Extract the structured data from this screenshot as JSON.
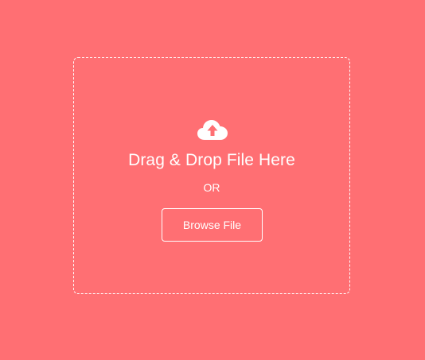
{
  "drop_zone": {
    "icon": "cloud-upload-icon",
    "headline": "Drag & Drop File Here",
    "separator": "OR",
    "browse_label": "Browse File"
  },
  "colors": {
    "background": "#FF6F73",
    "foreground": "#FFFFFF"
  }
}
